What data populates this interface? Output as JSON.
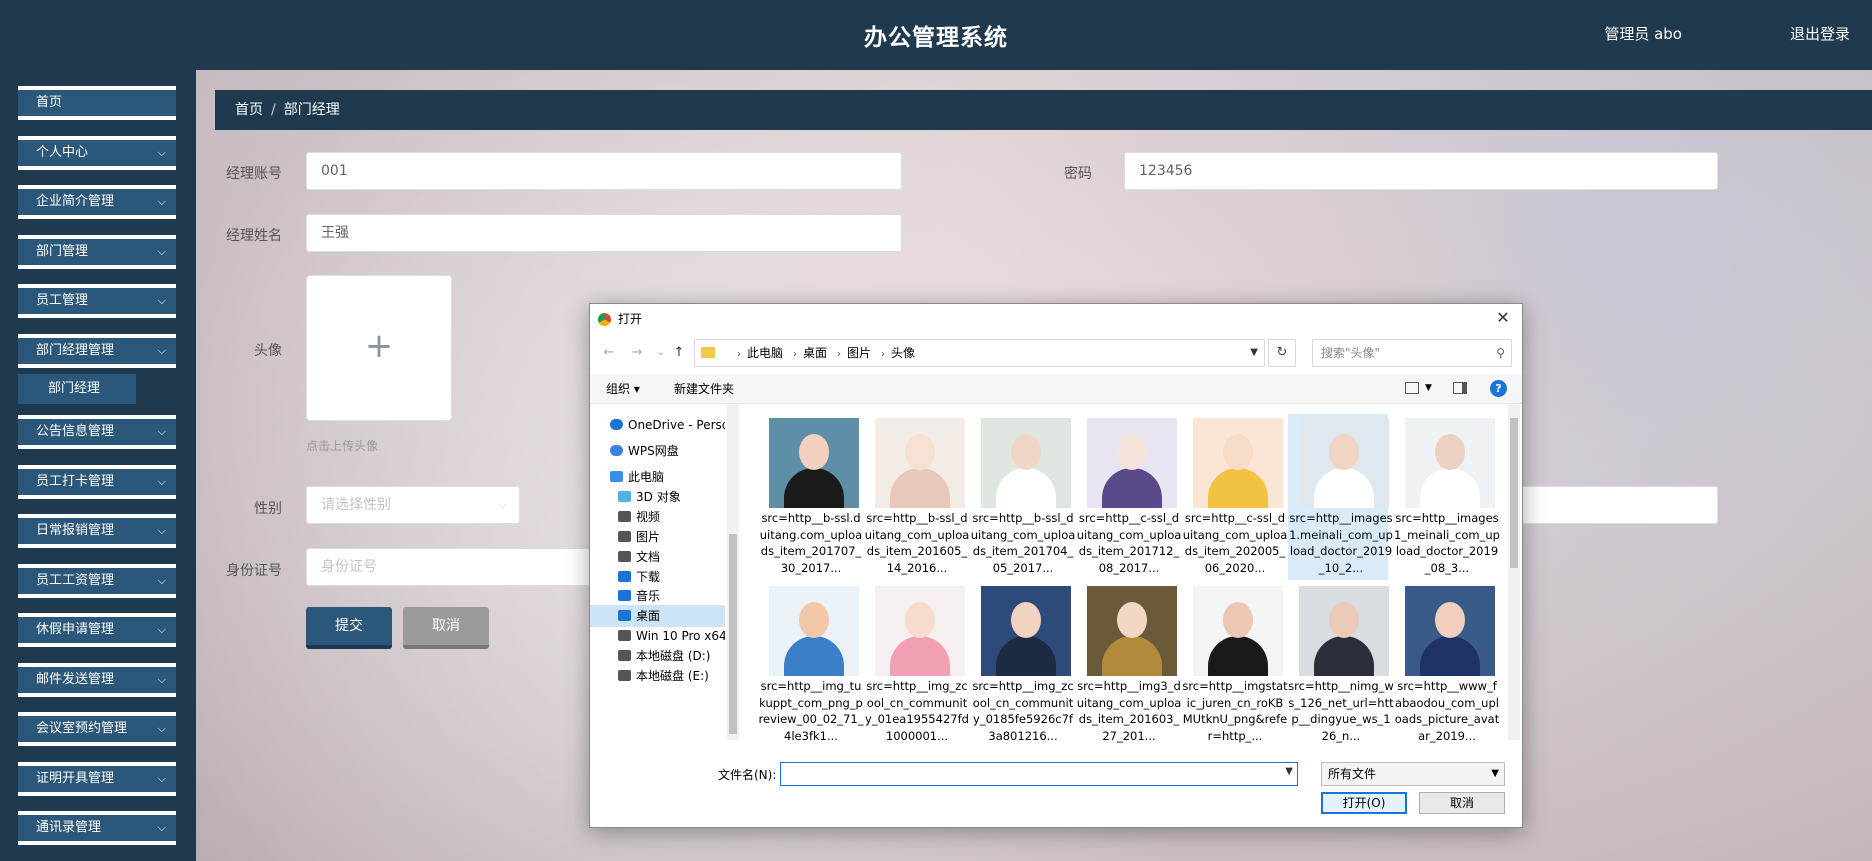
{
  "header": {
    "title": "办公管理系统",
    "user": "管理员 abo",
    "logout": "退出登录"
  },
  "sidebar": {
    "items": [
      {
        "label": "首页",
        "has_children": false
      },
      {
        "label": "个人中心",
        "has_children": true
      },
      {
        "label": "企业简介管理",
        "has_children": true
      },
      {
        "label": "部门管理",
        "has_children": true
      },
      {
        "label": "员工管理",
        "has_children": true
      },
      {
        "label": "部门经理管理",
        "has_children": true
      },
      {
        "label": "公告信息管理",
        "has_children": true
      },
      {
        "label": "员工打卡管理",
        "has_children": true
      },
      {
        "label": "日常报销管理",
        "has_children": true
      },
      {
        "label": "员工工资管理",
        "has_children": true
      },
      {
        "label": "休假申请管理",
        "has_children": true
      },
      {
        "label": "邮件发送管理",
        "has_children": true
      },
      {
        "label": "会议室预约管理",
        "has_children": true
      },
      {
        "label": "证明开具管理",
        "has_children": true
      },
      {
        "label": "通讯录管理",
        "has_children": true
      }
    ],
    "sub_item": "部门经理"
  },
  "breadcrumb": {
    "home": "首页",
    "separator": "/",
    "current": "部门经理"
  },
  "form": {
    "account_label": "经理账号",
    "account_value": "001",
    "password_label": "密码",
    "password_value": "123456",
    "name_label": "经理姓名",
    "name_value": "王强",
    "avatar_label": "头像",
    "avatar_plus": "+",
    "avatar_hint": "点击上传头像",
    "gender_label": "性别",
    "gender_placeholder": "请选择性别",
    "id_label": "身份证号",
    "id_placeholder": "身份证号",
    "submit": "提交",
    "cancel": "取消"
  },
  "dialog": {
    "title": "打开",
    "close": "✕",
    "nav": {
      "back": "←",
      "forward": "→",
      "recent": "⌄",
      "up": "↑"
    },
    "path": [
      "此电脑",
      "桌面",
      "图片",
      "头像"
    ],
    "path_sep": "›",
    "refresh": "↻",
    "search_placeholder": "搜索\"头像\"",
    "organize": "组织 ▾",
    "new_folder": "新建文件夹",
    "help": "?",
    "tree": [
      {
        "label": "OneDrive - Perso",
        "icon": "cloud-icon",
        "color": "#1a73d6",
        "indent": 1
      },
      {
        "label": "WPS网盘",
        "icon": "cloud-icon",
        "color": "#3b82e0",
        "indent": 1
      },
      {
        "label": "此电脑",
        "icon": "computer-icon",
        "color": "#3a8ee6",
        "indent": 1
      },
      {
        "label": "3D 对象",
        "icon": "cube-icon",
        "color": "#4fb3e8",
        "indent": 2
      },
      {
        "label": "视频",
        "icon": "video-icon",
        "color": "#555555",
        "indent": 2
      },
      {
        "label": "图片",
        "icon": "picture-icon",
        "color": "#555555",
        "indent": 2
      },
      {
        "label": "文档",
        "icon": "document-icon",
        "color": "#555555",
        "indent": 2
      },
      {
        "label": "下载",
        "icon": "download-icon",
        "color": "#1a73d6",
        "indent": 2
      },
      {
        "label": "音乐",
        "icon": "music-icon",
        "color": "#1a73d6",
        "indent": 2
      },
      {
        "label": "桌面",
        "icon": "desktop-icon",
        "color": "#1a73d6",
        "indent": 2,
        "selected": true
      },
      {
        "label": "Win 10 Pro x64",
        "icon": "drive-icon",
        "color": "#555555",
        "indent": 2
      },
      {
        "label": "本地磁盘 (D:)",
        "icon": "drive-icon",
        "color": "#555555",
        "indent": 2
      },
      {
        "label": "本地磁盘 (E:)",
        "icon": "drive-icon",
        "color": "#555555",
        "indent": 2
      }
    ],
    "files": [
      {
        "name": "src=http__b-ssl.duitang.com_uploads_item_201707_30_2017...",
        "bg": "#5f8fa6",
        "skin": "#f1d0c0",
        "cloth": "#1b1b1b"
      },
      {
        "name": "src=http__b-ssl_duitang_com_uploads_item_201605_14_2016...",
        "bg": "#f3ece6",
        "skin": "#f7e0d4",
        "cloth": "#e8c8b8"
      },
      {
        "name": "src=http__b-ssl_duitang_com_uploads_item_201704_05_2017...",
        "bg": "#dfe6e0",
        "skin": "#f0d6c6",
        "cloth": "#ffffff"
      },
      {
        "name": "src=http__c-ssl_duitang_com_uploads_item_201712_08_2017...",
        "bg": "#e9e4f2",
        "skin": "#f6e4dc",
        "cloth": "#5a4a8a"
      },
      {
        "name": "src=http__c-ssl_duitang_com_uploads_item_202005_06_2020...",
        "bg": "#fbe6d6",
        "skin": "#f6dcc6",
        "cloth": "#f4c242"
      },
      {
        "name": "src=http__images1.meinali_com_upload_doctor_2019_10_2...",
        "bg": "#dfe7ef",
        "skin": "#f0d4c4",
        "cloth": "#ffffff",
        "selected": true
      },
      {
        "name": "src=http__images1_meinali_com_upload_doctor_2019_08_3...",
        "bg": "#eef2f5",
        "skin": "#ecd0c0",
        "cloth": "#ffffff"
      },
      {
        "name": "src=http__img_tukuppt_com_png_preview_00_02_71_4le3fk1...",
        "bg": "#eaf2f8",
        "skin": "#f2c8a8",
        "cloth": "#3a7fc6"
      },
      {
        "name": "src=http__img_zcool_cn_community_01ea1955427fd1000001...",
        "bg": "#f7f0f0",
        "skin": "#f7dccd",
        "cloth": "#f2a0b4"
      },
      {
        "name": "src=http__img_zcool_cn_community_0185fe5926c7f3a801216...",
        "bg": "#2e4a7a",
        "skin": "#f2d2c0",
        "cloth": "#1c2a44"
      },
      {
        "name": "src=http__img3_duitang_com_uploads_item_201603_27_201...",
        "bg": "#6b5a3a",
        "skin": "#f2d8c2",
        "cloth": "#b08a3a"
      },
      {
        "name": "src=http__imgstatic_juren_cn_roKBMUtknU_png&refer=http_...",
        "bg": "#f4f4f4",
        "skin": "#ecc8b4",
        "cloth": "#1a1a1a"
      },
      {
        "name": "src=http__nimg_ws_126_net_url=http__dingyue_ws_126_n...",
        "bg": "#d8dde2",
        "skin": "#ecccb8",
        "cloth": "#2a2f3a"
      },
      {
        "name": "src=http__www_fabaodou_com_uploads_picture_avatar_2019...",
        "bg": "#3a5a8a",
        "skin": "#f0d0bc",
        "cloth": "#1e3266"
      }
    ],
    "filename_label": "文件名(N):",
    "filename_value": "",
    "filetype": "所有文件",
    "open": "打开(O)",
    "cancel": "取消"
  }
}
